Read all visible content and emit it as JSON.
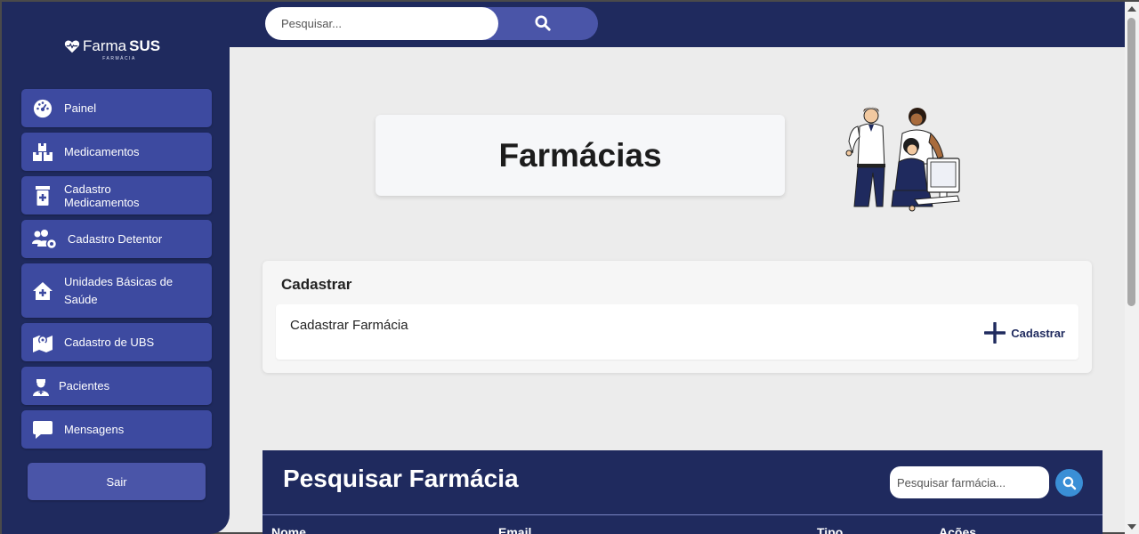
{
  "logo": {
    "light": "Farma",
    "bold": "SUS",
    "sub": "FARMÁCIA"
  },
  "sidebar": {
    "items": [
      {
        "label": "Painel",
        "icon": "dashboard-icon"
      },
      {
        "label": "Medicamentos",
        "icon": "boxes-icon"
      },
      {
        "label": "Cadastro Medicamentos",
        "icon": "prescription-bottle-icon"
      },
      {
        "label": "Cadastro Detentor",
        "icon": "users-gear-icon"
      },
      {
        "label": "Unidades Básicas de Saúde",
        "icon": "house-medical-icon"
      },
      {
        "label": "Cadastro de UBS",
        "icon": "map-location-icon"
      },
      {
        "label": "Pacientes",
        "icon": "user-doctor-icon"
      },
      {
        "label": "Mensagens",
        "icon": "message-icon"
      }
    ],
    "logout_label": "Sair"
  },
  "topbar": {
    "search_placeholder": "Pesquisar..."
  },
  "page": {
    "title": "Farmácias"
  },
  "register": {
    "title": "Cadastrar",
    "row_label": "Cadastrar Farmácia",
    "action_label": "Cadastrar"
  },
  "pharmacy_search": {
    "title": "Pesquisar Farmácia",
    "placeholder": "Pesquisar farmácia...",
    "columns": [
      "Nome",
      "Email",
      "Tipo",
      "Ações"
    ]
  },
  "colors": {
    "navy": "#1f2a5e",
    "nav_button": "#3d4aa0",
    "search_button": "#3a8fd6"
  }
}
